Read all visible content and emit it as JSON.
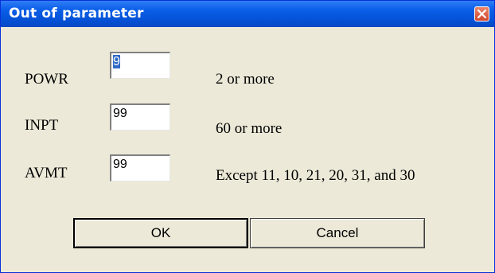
{
  "dialog": {
    "title": "Out of parameter",
    "close_icon": "close-icon",
    "close_color": "#d2462a",
    "titlebar_color": "#0553d8"
  },
  "params": [
    {
      "label": "POWR",
      "value": "9",
      "hint": "2 or more",
      "selected": true
    },
    {
      "label": "INPT",
      "value": "99",
      "hint": "60 or more",
      "selected": false
    },
    {
      "label": "AVMT",
      "value": "99",
      "hint": "Except 11, 10, 21, 20, 31, and 30",
      "selected": false
    }
  ],
  "buttons": {
    "ok_label": "OK",
    "cancel_label": "Cancel"
  }
}
